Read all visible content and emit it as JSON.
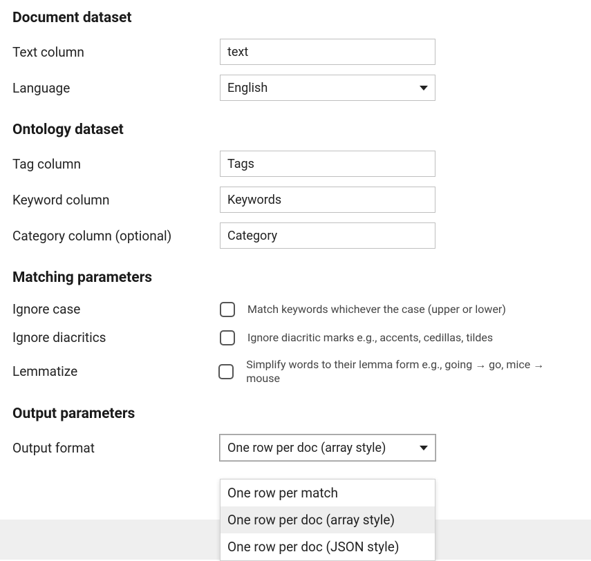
{
  "sections": {
    "document": {
      "title": "Document dataset",
      "text_column_label": "Text column",
      "text_column_value": "text",
      "language_label": "Language",
      "language_value": "English"
    },
    "ontology": {
      "title": "Ontology dataset",
      "tag_column_label": "Tag column",
      "tag_column_value": "Tags",
      "keyword_column_label": "Keyword column",
      "keyword_column_value": "Keywords",
      "category_column_label": "Category column (optional)",
      "category_column_value": "Category"
    },
    "matching": {
      "title": "Matching parameters",
      "ignore_case_label": "Ignore case",
      "ignore_case_desc": "Match keywords whichever the case (upper or lower)",
      "ignore_diacritics_label": "Ignore diacritics",
      "ignore_diacritics_desc": "Ignore diacritic marks e.g., accents, cedillas, tildes",
      "lemmatize_label": "Lemmatize",
      "lemmatize_desc": "Simplify words to their lemma form e.g., going → go, mice → mouse"
    },
    "output": {
      "title": "Output parameters",
      "format_label": "Output format",
      "format_value": "One row per doc (array style)",
      "options": {
        "a": "One row per match",
        "b": "One row per doc (array style)",
        "c": "One row per doc (JSON style)"
      }
    }
  }
}
